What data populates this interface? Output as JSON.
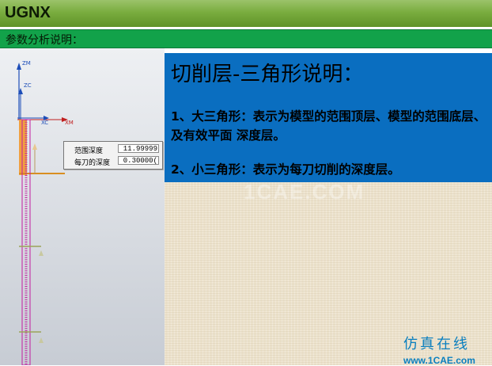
{
  "header": {
    "title": "UGNX"
  },
  "section": {
    "title": "参数分析说明："
  },
  "viewport": {
    "axis_labels": {
      "zm": "ZM",
      "zc": "ZC",
      "xc": "XC",
      "xm": "XM"
    },
    "params": {
      "range_depth_label": "范围深度",
      "range_depth_value": "11.99999",
      "per_cut_depth_label": "每刀的深度",
      "per_cut_depth_value": "0.30000("
    }
  },
  "info": {
    "title": "切削层-三角形说明：",
    "item1": "1、大三角形：表示为模型的范围顶层、模型的范围底层、及有效平面 深度层。",
    "item2": "2、小三角形：表示为每刀切削的深度层。"
  },
  "watermark": {
    "text": "1CAE.COM"
  },
  "logo": {
    "cn": "仿真在线",
    "url": "www.1CAE.com"
  },
  "colors": {
    "header": "#7aad3f",
    "section": "#12a24a",
    "info": "#0a6ec0",
    "range": "#f0a040",
    "depth": "#c21ca0"
  }
}
